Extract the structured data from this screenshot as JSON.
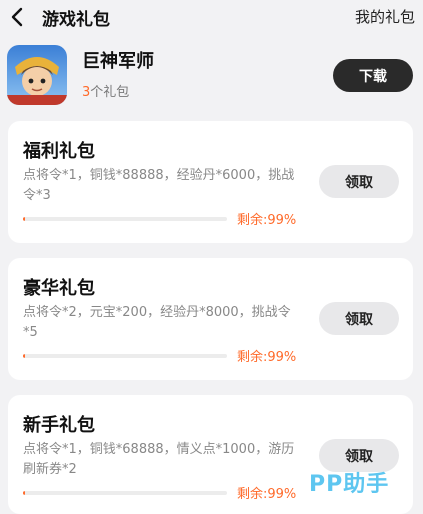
{
  "header": {
    "title": "游戏礼包",
    "right_link": "我的礼包",
    "back_icon": "chevron-left-icon"
  },
  "app": {
    "name": "巨神军师",
    "gift_count": "3",
    "gift_count_suffix": "个礼包",
    "download_label": "下载"
  },
  "packs": [
    {
      "title": "福利礼包",
      "description": "点将令*1，铜钱*88888，经验丹*6000，挑战令*3",
      "remaining_label": "剩余:99%",
      "remaining_fraction": 0.01,
      "claim_label": "领取"
    },
    {
      "title": "豪华礼包",
      "description": "点将令*2，元宝*200，经验丹*8000，挑战令*5",
      "remaining_label": "剩余:99%",
      "remaining_fraction": 0.01,
      "claim_label": "领取"
    },
    {
      "title": "新手礼包",
      "description": "点将令*1，铜钱*68888，情义点*1000，游历刷新券*2",
      "remaining_label": "剩余:99%",
      "remaining_fraction": 0.01,
      "claim_label": "领取"
    }
  ],
  "watermark": "PP助手",
  "colors": {
    "accent": "#ff6a2a",
    "download_button": "#2a2a2a",
    "claim_button": "#e8e8ea",
    "watermark": "#5ec6f0"
  }
}
